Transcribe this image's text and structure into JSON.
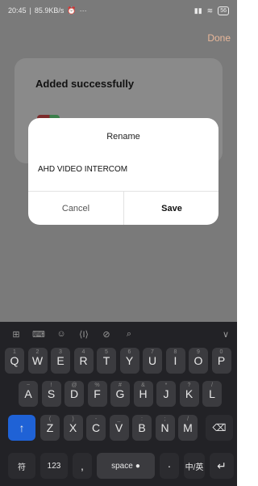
{
  "status_bar": {
    "time": "20:45",
    "net_speed": "85.9KB/s",
    "alarm_icon": "alarm-icon",
    "more": "···",
    "battery": "56"
  },
  "app": {
    "done_label": "Done",
    "card_title": "Added successfully"
  },
  "dialog": {
    "title": "Rename",
    "input_value": "AHD VIDEO INTERCOM",
    "cancel_label": "Cancel",
    "save_label": "Save"
  },
  "keyboard": {
    "toolbar": [
      "grid-icon",
      "keyboard-icon",
      "emoji-icon",
      "cursor-icon",
      "clipboard-icon",
      "search-icon",
      "collapse-icon"
    ],
    "row1": [
      {
        "k": "Q",
        "n": "1"
      },
      {
        "k": "W",
        "n": "2"
      },
      {
        "k": "E",
        "n": "3"
      },
      {
        "k": "R",
        "n": "4"
      },
      {
        "k": "T",
        "n": "5"
      },
      {
        "k": "Y",
        "n": "6"
      },
      {
        "k": "U",
        "n": "7"
      },
      {
        "k": "I",
        "n": "8"
      },
      {
        "k": "O",
        "n": "9"
      },
      {
        "k": "P",
        "n": "0"
      }
    ],
    "row2": [
      {
        "k": "A",
        "n": "~"
      },
      {
        "k": "S",
        "n": "!"
      },
      {
        "k": "D",
        "n": "@"
      },
      {
        "k": "F",
        "n": "%"
      },
      {
        "k": "G",
        "n": "#"
      },
      {
        "k": "H",
        "n": "&"
      },
      {
        "k": "J",
        "n": "*"
      },
      {
        "k": "K",
        "n": "?"
      },
      {
        "k": "L",
        "n": "/"
      }
    ],
    "row3": [
      {
        "k": "Z",
        "n": "("
      },
      {
        "k": "X",
        "n": ")"
      },
      {
        "k": "C",
        "n": "-"
      },
      {
        "k": "V",
        "n": "_"
      },
      {
        "k": "B",
        "n": ":"
      },
      {
        "k": "N",
        "n": ";"
      },
      {
        "k": "M",
        "n": "/"
      }
    ],
    "shift_icon": "↑",
    "backspace_icon": "⌫",
    "symbol_key": "符",
    "num_key": "123",
    "comma_key": ",",
    "space_label": "space",
    "period_key": "·",
    "lang_key": "中/英",
    "enter_icon": "↵"
  }
}
